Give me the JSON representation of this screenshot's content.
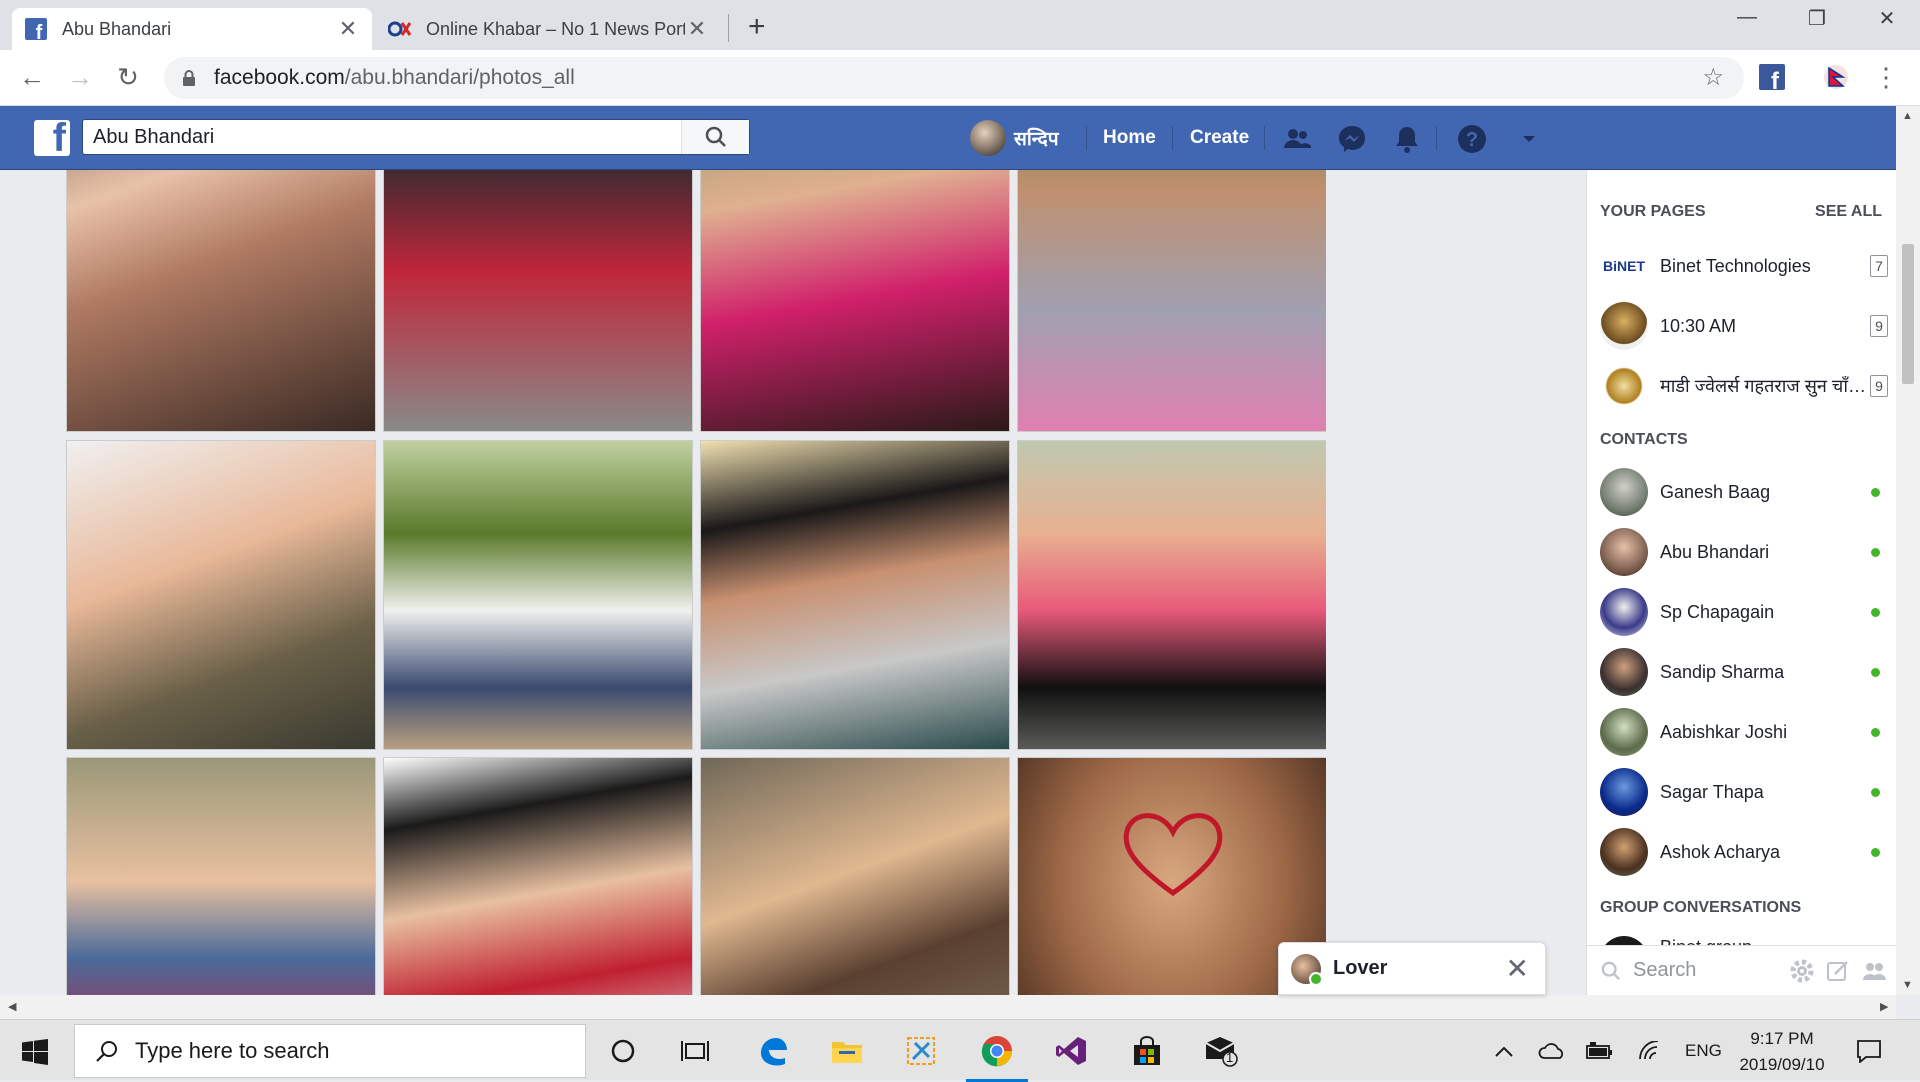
{
  "browser": {
    "tabs": [
      {
        "title": "Abu Bhandari",
        "active": true
      },
      {
        "title": "Online Khabar – No 1 News Portal",
        "active": false
      }
    ],
    "url": {
      "host": "facebook.com",
      "path": "/abu.bhandari/photos_all"
    }
  },
  "facebook": {
    "search_value": "Abu Bhandari",
    "profile_name": "सन्दिप",
    "nav": {
      "home": "Home",
      "create": "Create"
    }
  },
  "photos": [
    {
      "caption": ""
    },
    {
      "caption": ""
    },
    {
      "caption": ""
    },
    {
      "caption": ""
    },
    {
      "caption": ""
    },
    {
      "caption": ""
    },
    {
      "caption": ""
    },
    {
      "caption": ""
    },
    {
      "caption": ""
    },
    {
      "caption": ""
    },
    {
      "caption": ""
    },
    {
      "caption": ""
    }
  ],
  "sidebar": {
    "your_pages_heading": "YOUR PAGES",
    "see_all": "SEE ALL",
    "pages": [
      {
        "name": "Binet Technologies",
        "count": "7"
      },
      {
        "name": "10:30 AM",
        "count": "9"
      },
      {
        "name": "माडी ज्वेलर्स गहतराज सुन चाँदी पसल",
        "count": "9"
      }
    ],
    "contacts_heading": "CONTACTS",
    "contacts": [
      {
        "name": "Ganesh Baag"
      },
      {
        "name": "Abu Bhandari"
      },
      {
        "name": "Sp Chapagain"
      },
      {
        "name": "Sandip Sharma"
      },
      {
        "name": "Aabishkar Joshi"
      },
      {
        "name": "Sagar Thapa"
      },
      {
        "name": "Ashok Acharya"
      }
    ],
    "group_heading": "GROUP CONVERSATIONS",
    "group_partial": "Binet group",
    "search_placeholder": "Search"
  },
  "chat": {
    "name": "Lover"
  },
  "taskbar": {
    "search_placeholder": "Type here to search",
    "language": "ENG",
    "time": "9:17 PM",
    "date": "2019/09/10",
    "mail_badge": "1"
  },
  "colors": {
    "facebook_blue": "#4267b2",
    "online_green": "#42b72a"
  }
}
